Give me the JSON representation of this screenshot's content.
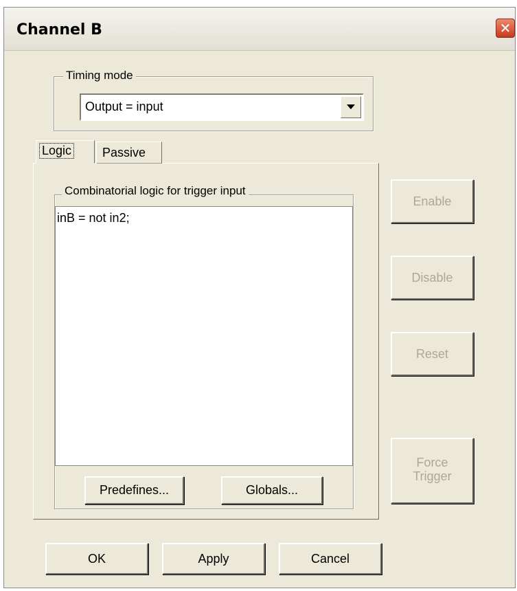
{
  "window": {
    "title": "Channel B",
    "close_glyph": "✕"
  },
  "timing": {
    "legend": "Timing mode",
    "selected": "Output = input"
  },
  "tabs": [
    {
      "label": "Logic",
      "active": true
    },
    {
      "label": "Passive",
      "active": false
    }
  ],
  "logic": {
    "legend": "Combinatorial logic for trigger input",
    "code": "inB = not in2;",
    "predefines_label": "Predefines...",
    "globals_label": "Globals..."
  },
  "side_buttons": {
    "enable": "Enable",
    "disable": "Disable",
    "reset": "Reset",
    "force_line1": "Force",
    "force_line2": "Trigger"
  },
  "footer": {
    "ok": "OK",
    "apply": "Apply",
    "cancel": "Cancel"
  },
  "colors": {
    "face": "#ece9d8",
    "disabled_text": "#aca899",
    "close_red": "#c6391c"
  }
}
